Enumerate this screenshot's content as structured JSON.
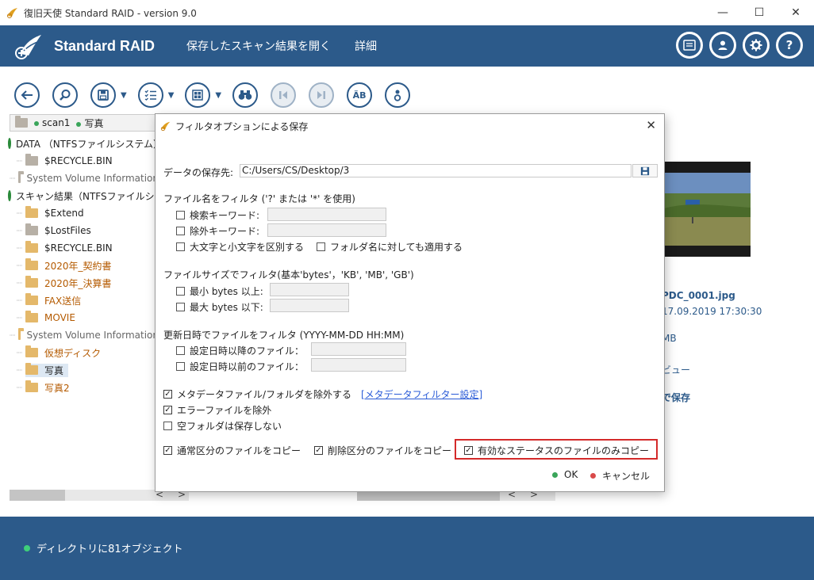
{
  "window": {
    "title": "復旧天使 Standard RAID - version 9.0",
    "minimize_glyph": "—",
    "maximize_glyph": "☐",
    "close_glyph": "✕"
  },
  "header": {
    "brand": "Standard RAID",
    "menu": [
      "保存したスキャン結果を開く",
      "詳細"
    ],
    "icons": [
      "list-icon",
      "user-icon",
      "gear-icon",
      "help-icon"
    ],
    "help_glyph": "?"
  },
  "toolbar": {
    "buttons": [
      "back-icon",
      "search-icon",
      "save-icon",
      "filter-list-icon",
      "view-icon",
      "binoculars-icon",
      "prev-icon",
      "next-icon",
      "case-icon",
      "info-icon"
    ],
    "case_glyph": "ÄB"
  },
  "path": {
    "items": [
      "scan1",
      "写真"
    ]
  },
  "tree": {
    "rows": [
      {
        "label": "DATA （NTFSファイルシステム）",
        "type": "drive"
      },
      {
        "label": "$RECYCLE.BIN",
        "type": "folder-gray"
      },
      {
        "label": "System Volume Information",
        "type": "folder-gray"
      },
      {
        "label": "スキャン結果（NTFSファイルシステム）",
        "type": "drive"
      },
      {
        "label": "$Extend",
        "type": "folder"
      },
      {
        "label": "$LostFiles",
        "type": "folder-gray"
      },
      {
        "label": "$RECYCLE.BIN",
        "type": "folder"
      },
      {
        "label": "2020年_契約書",
        "type": "folder"
      },
      {
        "label": "2020年_決算書",
        "type": "folder"
      },
      {
        "label": "FAX送信",
        "type": "folder"
      },
      {
        "label": "MOVIE",
        "type": "folder"
      },
      {
        "label": "System Volume Information",
        "type": "folder"
      },
      {
        "label": "仮想ディスク",
        "type": "folder"
      },
      {
        "label": "写真",
        "type": "folder"
      },
      {
        "label": "写真2",
        "type": "folder"
      }
    ]
  },
  "preview": {
    "filename": "PDC_0001.jpg",
    "datetime": "17.09.2019 17:30:30",
    "size": "MB",
    "preview_link": "ビュー",
    "save_link": "で保存"
  },
  "scroll": {
    "left_glyph": "<",
    "right_glyph": ">"
  },
  "status": {
    "text": "ディレクトリに81オブジェクト"
  },
  "dialog": {
    "title": "フィルタオプションによる保存",
    "close_glyph": "✕",
    "checked_glyph": "✓",
    "save_to_label": "データの保存先:",
    "save_to_value": "C:/Users/CS/Desktop/3",
    "name_filter_heading": "ファイル名をフィルタ ('?' または '*' を使用)",
    "search_keyword": "検索キーワード:",
    "exclude_keyword": "除外キーワード:",
    "case_sensitive": "大文字と小文字を区別する",
    "apply_to_folders": "フォルダ名に対しても適用する",
    "size_filter_heading": "ファイルサイズでフィルタ(基本'bytes'，'KB', 'MB', 'GB')",
    "min_bytes": "最小 bytes 以上:",
    "max_bytes": "最大 bytes 以下:",
    "date_filter_heading": "更新日時でファイルをフィルタ (YYYY-MM-DD HH:MM)",
    "after_date": "設定日時以降のファイル：",
    "before_date": "設定日時以前のファイル：",
    "exclude_metadata": "メタデータファイル/フォルダを除外する",
    "metadata_link": "[メタデータフィルター設定]",
    "exclude_errors": "エラーファイルを除外",
    "no_empty_folders": "空フォルダは保存しない",
    "copy_normal": "通常区分のファイルをコピー",
    "copy_deleted": "削除区分のファイルをコピー",
    "copy_valid_only": "有効なステータスのファイルのみコピー",
    "ok": "OK",
    "cancel": "キャンセル"
  },
  "colors": {
    "header_bg": "#2c5a8a",
    "highlight": "#d42a2a",
    "ok_dot": "#3aa55a",
    "cancel_dot": "#d94a4a"
  }
}
